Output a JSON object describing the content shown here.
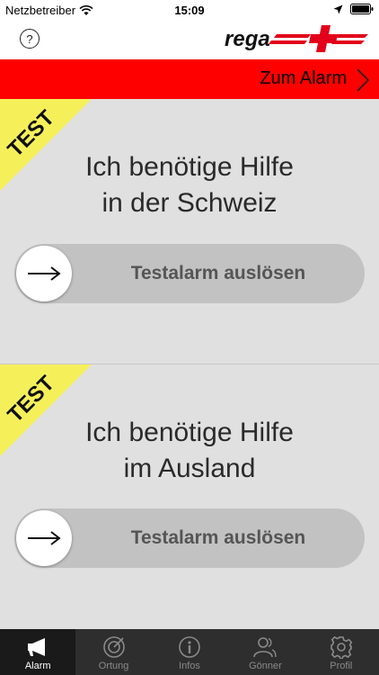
{
  "statusbar": {
    "carrier": "Netzbetreiber",
    "time": "15:09"
  },
  "header": {
    "help_label": "?",
    "logo_text": "rega"
  },
  "alarm_bar": {
    "label": "Zum Alarm"
  },
  "panels": [
    {
      "badge": "TEST",
      "title_line1": "Ich benötige Hilfe",
      "title_line2": "in der Schweiz",
      "slider_label": "Testalarm auslösen"
    },
    {
      "badge": "TEST",
      "title_line1": "Ich benötige Hilfe",
      "title_line2": "im Ausland",
      "slider_label": "Testalarm auslösen"
    }
  ],
  "tabs": [
    {
      "label": "Alarm",
      "icon": "megaphone-icon",
      "active": true
    },
    {
      "label": "Ortung",
      "icon": "target-icon",
      "active": false
    },
    {
      "label": "Infos",
      "icon": "info-icon",
      "active": false
    },
    {
      "label": "Gönner",
      "icon": "people-icon",
      "active": false
    },
    {
      "label": "Profil",
      "icon": "gear-icon",
      "active": false
    }
  ],
  "colors": {
    "alarm_red": "#ff0000",
    "test_yellow": "#f5f05a",
    "panel_bg": "#e0e0e0",
    "tabbar_bg": "#2e2e2e"
  }
}
